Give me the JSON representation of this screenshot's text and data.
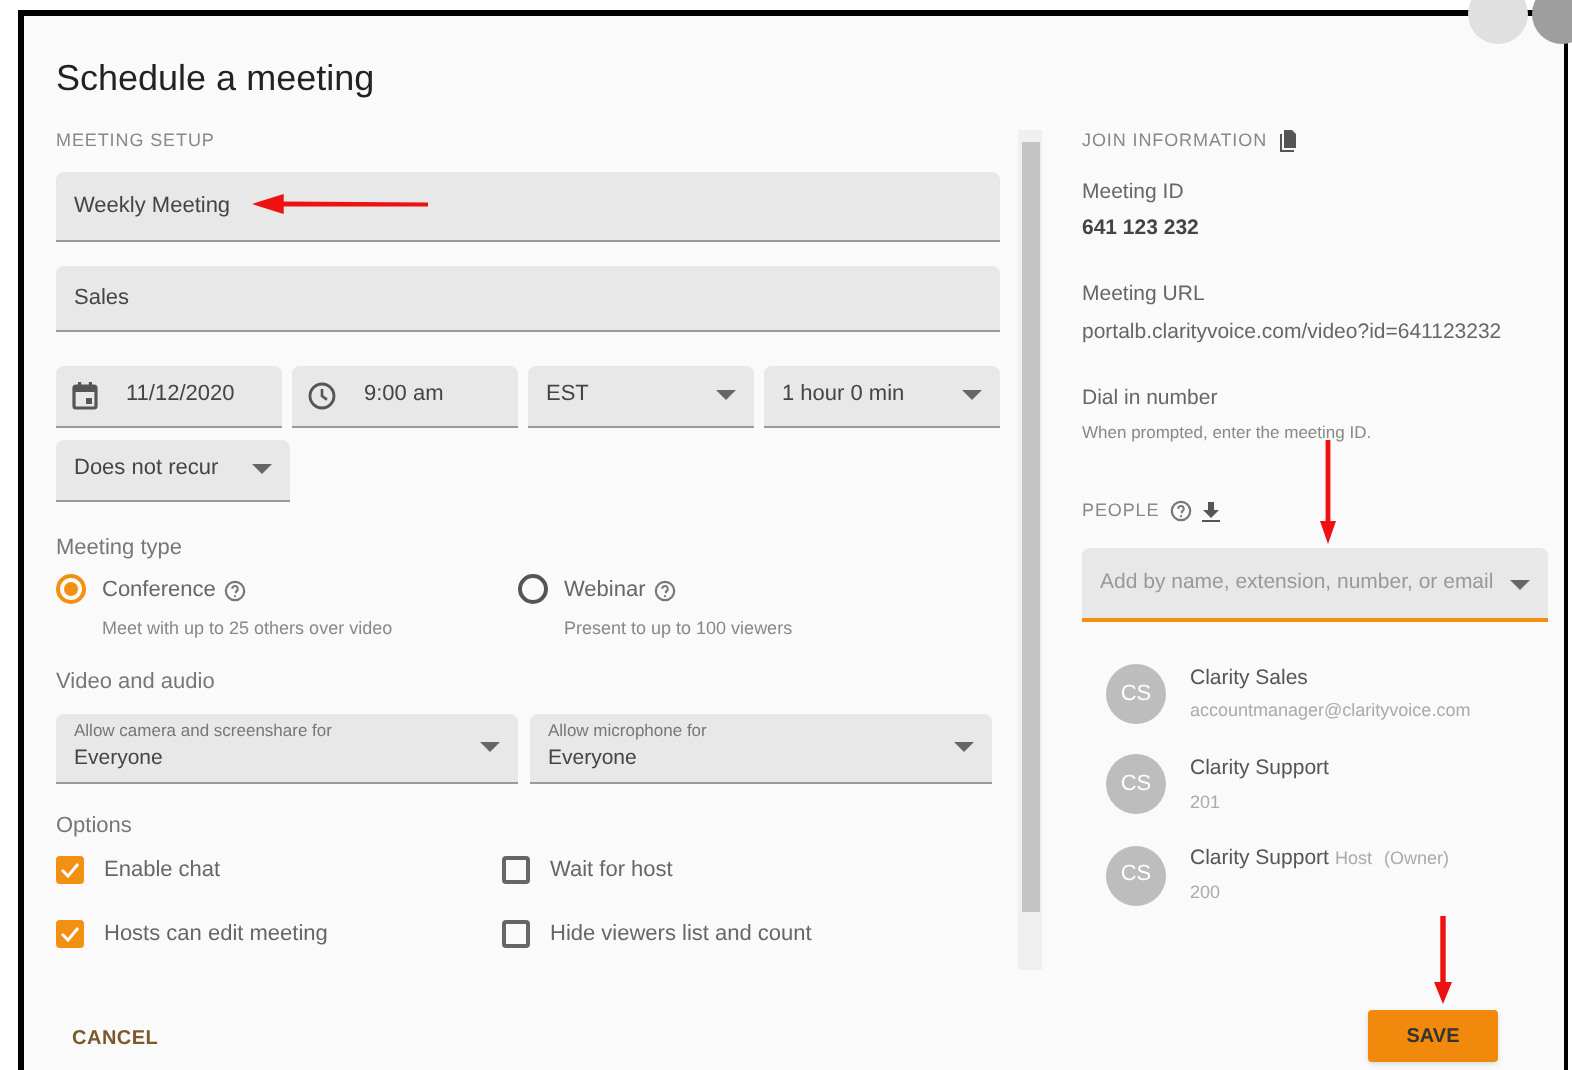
{
  "dialog": {
    "title": "Schedule a meeting"
  },
  "setup": {
    "heading": "MEETING SETUP",
    "title_field": {
      "value": "Weekly Meeting"
    },
    "description_field": {
      "value": "Sales"
    },
    "date": {
      "value": "11/12/2020"
    },
    "time": {
      "value": "9:00 am"
    },
    "timezone": {
      "value": "EST"
    },
    "duration": {
      "value": "1 hour 0 min"
    },
    "recurrence": {
      "value": "Does not recur"
    },
    "meeting_type": {
      "label": "Meeting type",
      "options": [
        {
          "label": "Conference",
          "description": "Meet with up to 25 others over video",
          "selected": true
        },
        {
          "label": "Webinar",
          "description": "Present to up to 100 viewers",
          "selected": false
        }
      ]
    },
    "video_audio": {
      "label": "Video and audio",
      "selects": [
        {
          "label": "Allow camera and screenshare for",
          "value": "Everyone"
        },
        {
          "label": "Allow microphone for",
          "value": "Everyone"
        }
      ]
    },
    "options": {
      "label": "Options",
      "items": [
        {
          "label": "Enable chat",
          "checked": true
        },
        {
          "label": "Wait for host",
          "checked": false
        },
        {
          "label": "Hosts can edit meeting",
          "checked": true
        },
        {
          "label": "Hide viewers list and count",
          "checked": false
        }
      ]
    }
  },
  "join": {
    "heading": "JOIN INFORMATION",
    "fields": [
      {
        "label": "Meeting ID",
        "value": "641 123 232",
        "kind": "bold"
      },
      {
        "label": "Meeting URL",
        "value": "portalb.clarityvoice.com/video?id=641123232",
        "kind": "plain"
      },
      {
        "label": "Dial in number",
        "value": "When prompted, enter the meeting ID.",
        "kind": "hint"
      }
    ]
  },
  "people": {
    "heading": "PEOPLE",
    "search": {
      "placeholder": "Add by name, extension, number, or email"
    },
    "list": [
      {
        "initials": "CS",
        "name": "Clarity Sales",
        "detail": "accountmanager@clarityvoice.com"
      },
      {
        "initials": "CS",
        "name": "Clarity Support",
        "detail": "201"
      },
      {
        "initials": "CS",
        "name": "Clarity Support",
        "role": "Host",
        "owner": "(Owner)",
        "detail": "200"
      }
    ]
  },
  "buttons": {
    "cancel": "CANCEL",
    "save": "SAVE"
  }
}
